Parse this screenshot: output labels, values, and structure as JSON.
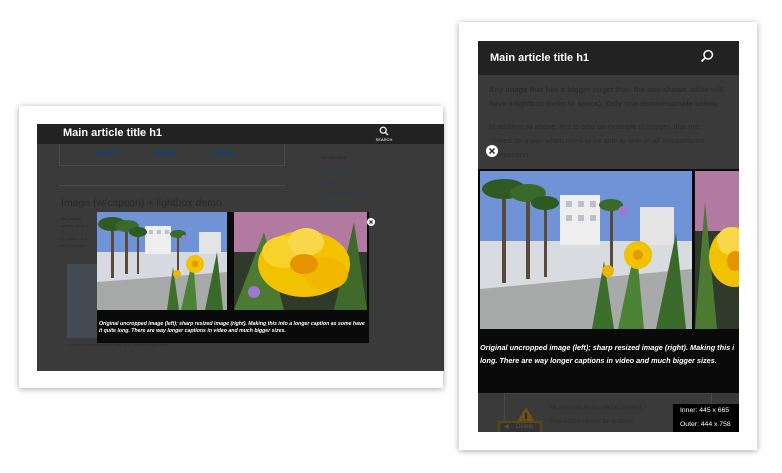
{
  "left_mock": {
    "header_title": "Main article title h1",
    "search_label": "SEARCH",
    "section_heading": "Image (w/caption) + lightbox demo",
    "sidebar": {
      "heading": "ON THIS PAGE",
      "links": [
        "Demo product tab",
        "Templates",
        "Browser and device settings",
        "Results of mobile app"
      ]
    },
    "body_snippets": [
      "Any image",
      "space). Only o",
      "In addition to a",
      "be side to side"
    ],
    "caption": "Original uncropped image (left); sharp resized image (right). Making this into a longer caption as some have it quite long. There are way longer captions in video and much bigger sizes.",
    "bottom_caption": "Original uncropped image (left); sharp resized image (right)"
  },
  "right_mock": {
    "header_title": "Main article title h1",
    "paragraph_bold": "Any image that has a bigger target than the one shown inline will have a lightbox (refer to specs). Only one demo/example below.",
    "paragraph2": "In addition to above, this is also an example of images that are \"linked\"/in a pair when need to be side to side in all viewports for comparison.",
    "caption": "Original uncropped image (left); sharp resized image (right). Making this i long. There are way longer captions in video and much bigger sizes.",
    "alert_line1": "All selected items will be cleared.",
    "alert_line2": "This action cannot be undone.",
    "button_label": "Delete",
    "viewport_inner": "Inner: 445 x 665",
    "viewport_outer": "Outer: 444 x 758"
  },
  "colors": {
    "header": "#222222",
    "overlay": "#3a3a3a",
    "flower": "#f2c200",
    "sky": "#6f93d6"
  }
}
